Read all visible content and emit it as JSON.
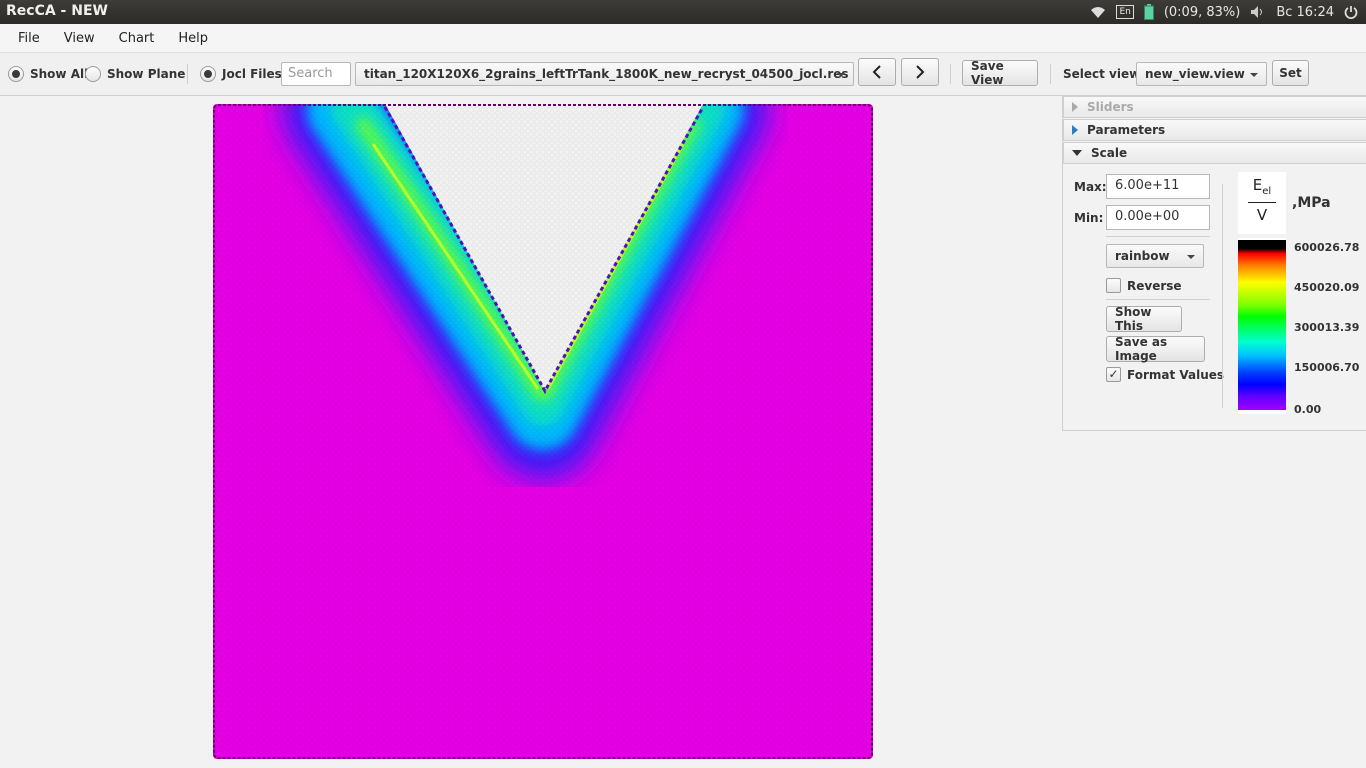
{
  "window": {
    "title": "RecCA - NEW"
  },
  "tray": {
    "keyboard": "En",
    "battery": "(0:09, 83%)",
    "clock": "Вс 16:24"
  },
  "menu": [
    "File",
    "View",
    "Chart",
    "Help"
  ],
  "toolbar": {
    "show_all": "Show All",
    "show_plane": "Show Plane",
    "jocl_files": "Jocl Files",
    "search_placeholder": "Search",
    "file_selected": "titan_120X120X6_2grains_leftTrTank_1800K_new_recryst_04500_jocl.res",
    "prev_icon": "‹",
    "next_icon": "›",
    "save_view": "Save View",
    "select_view_label": "Select view:",
    "select_view_value": "new_view.view",
    "set": "Set"
  },
  "panel": {
    "sliders": "Sliders",
    "parameters": "Parameters",
    "scale": "Scale",
    "max_label": "Max:",
    "max_value": "6.00e+11",
    "min_label": "Min:",
    "min_value": "0.00e+00",
    "palette": "rainbow",
    "reverse": "Reverse",
    "reverse_checked": false,
    "show_this": "Show This",
    "save_image": "Save as Image",
    "format_values": "Format Values",
    "format_checked": true,
    "unit_num": "E",
    "unit_sub": "el",
    "unit_den": "V",
    "unit": ",MPa",
    "ticks": [
      "600026.78",
      "450020.09",
      "300013.39",
      "150006.70",
      "0.00"
    ]
  },
  "colors": {
    "field_bg": "#e600e6",
    "accent": "#2d7cc5"
  }
}
